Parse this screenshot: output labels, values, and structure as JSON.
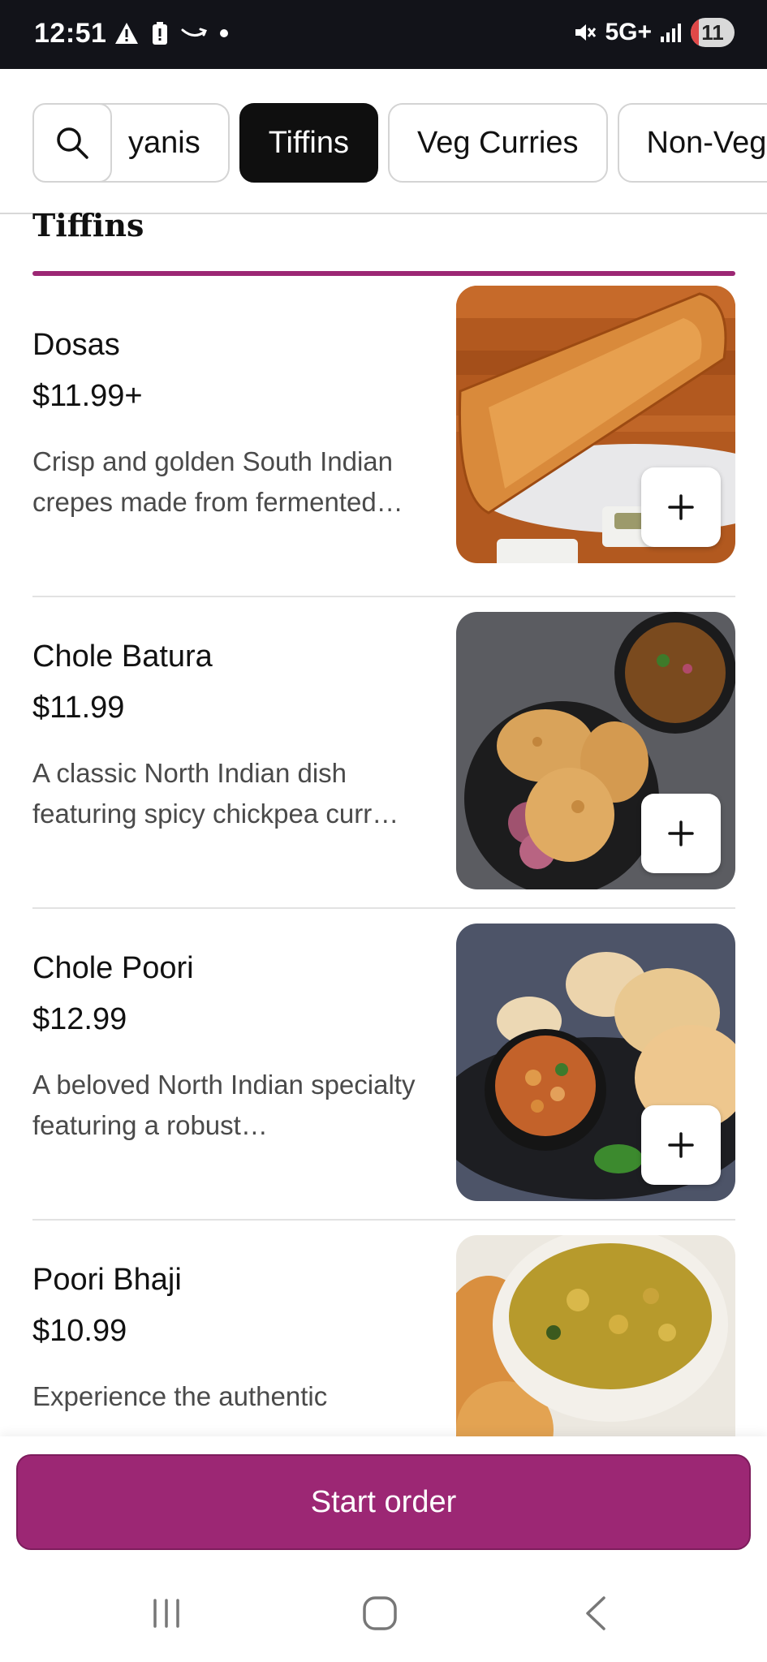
{
  "status_bar": {
    "time": "12:51",
    "network": "5G+",
    "battery": "11",
    "icons": [
      "warning-icon",
      "battery-alert-icon",
      "amazon-smile-icon",
      "dot-icon",
      "mute-icon",
      "signal-icon"
    ]
  },
  "categories": {
    "items": [
      {
        "label": "yanis",
        "active": false
      },
      {
        "label": "Tiffins",
        "active": true
      },
      {
        "label": "Veg Curries",
        "active": false
      },
      {
        "label": "Non-Veg",
        "active": false
      }
    ]
  },
  "section": {
    "title": "Tiffins"
  },
  "items": [
    {
      "name": "Dosas",
      "price": "$11.99+",
      "description": "Crisp and golden South Indian crepes made from fermented…",
      "image": "dosa-photo"
    },
    {
      "name": "Chole Batura",
      "price": "$11.99",
      "description": "A classic North Indian dish featuring spicy chickpea curr…",
      "image": "chole-batura-photo"
    },
    {
      "name": "Chole Poori",
      "price": "$12.99",
      "description": "A beloved North Indian specialty featuring a robust…",
      "image": "chole-poori-photo"
    },
    {
      "name": "Poori Bhaji",
      "price": "$10.99",
      "description": "Experience the authentic",
      "image": "poori-bhaji-photo"
    }
  ],
  "cta": {
    "label": "Start order"
  },
  "colors": {
    "accent": "#9c2774",
    "chip_active": "#0f0f0f",
    "status_bar": "#121319"
  },
  "nav": {
    "icons": [
      "recent-apps-icon",
      "home-icon",
      "back-icon"
    ]
  }
}
